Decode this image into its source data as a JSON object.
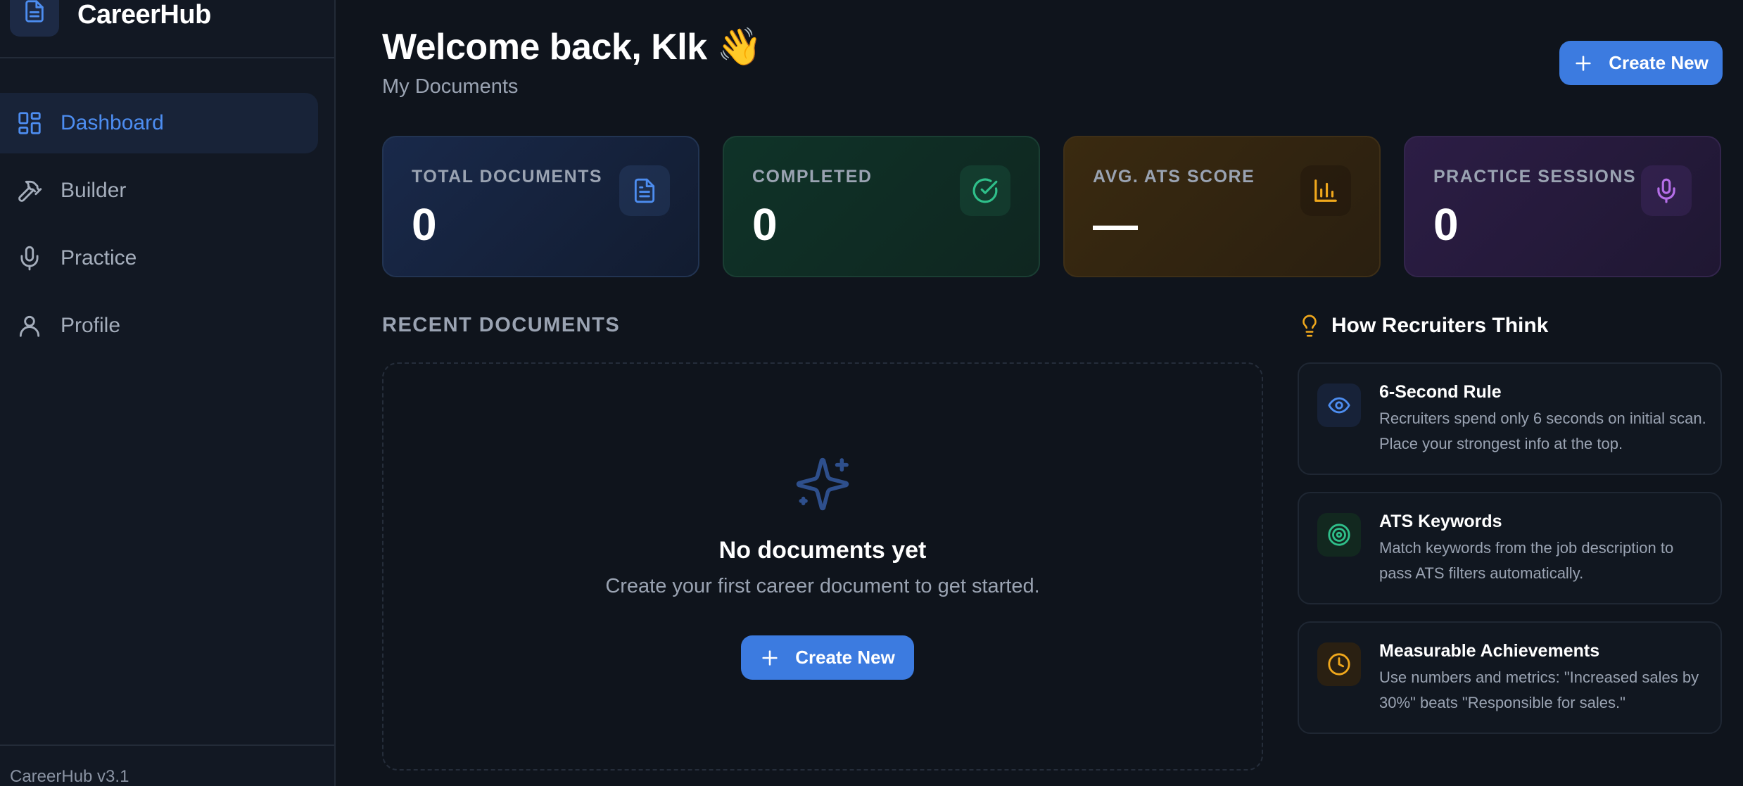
{
  "brand": {
    "name": "CareerHub",
    "version": "CareerHub v3.1"
  },
  "sidebar": {
    "items": [
      {
        "label": "Dashboard",
        "icon": "dashboard-icon",
        "active": true
      },
      {
        "label": "Builder",
        "icon": "hammer-icon",
        "active": false
      },
      {
        "label": "Practice",
        "icon": "microphone-icon",
        "active": false
      },
      {
        "label": "Profile",
        "icon": "user-icon",
        "active": false
      }
    ]
  },
  "header": {
    "title": "Welcome back, Klk 👋",
    "subtitle": "My Documents",
    "create_label": "Create New"
  },
  "stats": [
    {
      "label": "TOTAL DOCUMENTS",
      "value": "0",
      "icon": "document-icon",
      "color": "#4d8df0"
    },
    {
      "label": "COMPLETED",
      "value": "0",
      "icon": "check-circle-icon",
      "color": "#2fbf8a"
    },
    {
      "label": "AVG. ATS SCORE",
      "value": "—",
      "icon": "bar-chart-icon",
      "color": "#f0a81c"
    },
    {
      "label": "PRACTICE SESSIONS",
      "value": "0",
      "icon": "microphone-icon",
      "color": "#b56ee8"
    }
  ],
  "recent": {
    "title": "RECENT DOCUMENTS",
    "empty_title": "No documents yet",
    "empty_desc": "Create your first career document to get started.",
    "create_label": "Create New"
  },
  "tips": {
    "title": "How Recruiters Think",
    "items": [
      {
        "title": "6-Second Rule",
        "desc": "Recruiters spend only 6 seconds on initial scan. Place your strongest info at the top.",
        "icon": "eye-icon",
        "color": "#4d8df0"
      },
      {
        "title": "ATS Keywords",
        "desc": "Match keywords from the job description to pass ATS filters automatically.",
        "icon": "target-icon",
        "color": "#2fbf8a"
      },
      {
        "title": "Measurable Achievements",
        "desc": "Use numbers and metrics: \"Increased sales by 30%\" beats \"Responsible for sales.\"",
        "icon": "clock-icon",
        "color": "#f0a81c"
      }
    ]
  },
  "colors": {
    "accent": "#3c7be0",
    "background": "#0f141c",
    "sidebar": "#121823"
  }
}
